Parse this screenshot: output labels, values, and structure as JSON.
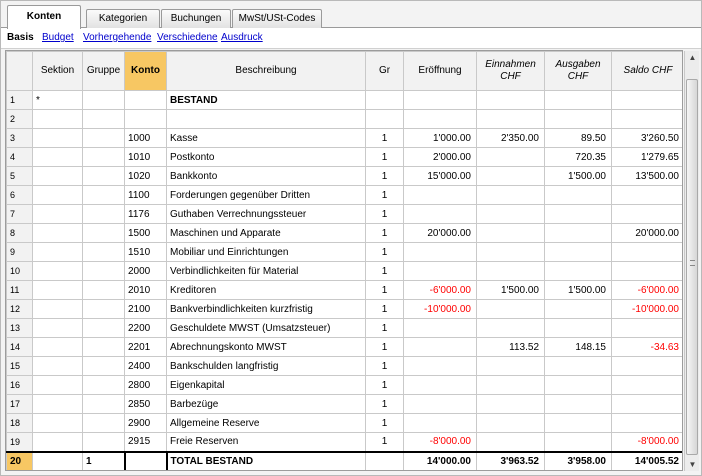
{
  "tabs": [
    {
      "label": "Konten",
      "active": true
    },
    {
      "label": "Kategorien",
      "active": false
    },
    {
      "label": "Buchungen",
      "active": false
    },
    {
      "label": "MwSt/USt-Codes",
      "active": false
    }
  ],
  "views": [
    {
      "label": "Basis",
      "current": true
    },
    {
      "label": "Budget",
      "current": false
    },
    {
      "label": "Vorhergehende",
      "current": false
    },
    {
      "label": "Verschiedene",
      "current": false
    },
    {
      "label": "Ausdruck",
      "current": false
    }
  ],
  "columns": {
    "rownum": "",
    "sektion": "Sektion",
    "gruppe": "Gruppe",
    "konto": "Konto",
    "beschreibung": "Beschreibung",
    "gr": "Gr",
    "eroeffnung": "Eröffnung",
    "einnahmen_1": "Einnahmen",
    "einnahmen_2": "CHF",
    "ausgaben_1": "Ausgaben",
    "ausgaben_2": "CHF",
    "saldo": "Saldo CHF"
  },
  "rows": [
    {
      "n": "1",
      "sektion": "*",
      "gruppe": "",
      "konto": "",
      "beschreibung": "BESTAND",
      "gr": "",
      "eroeffnung": "",
      "einnahmen": "",
      "ausgaben": "",
      "saldo": "",
      "bold": true
    },
    {
      "n": "2",
      "sektion": "",
      "gruppe": "",
      "konto": "",
      "beschreibung": "",
      "gr": "",
      "eroeffnung": "",
      "einnahmen": "",
      "ausgaben": "",
      "saldo": ""
    },
    {
      "n": "3",
      "sektion": "",
      "gruppe": "",
      "konto": "1000",
      "beschreibung": "Kasse",
      "gr": "1",
      "eroeffnung": "1'000.00",
      "einnahmen": "2'350.00",
      "ausgaben": "89.50",
      "saldo": "3'260.50"
    },
    {
      "n": "4",
      "sektion": "",
      "gruppe": "",
      "konto": "1010",
      "beschreibung": "Postkonto",
      "gr": "1",
      "eroeffnung": "2'000.00",
      "einnahmen": "",
      "ausgaben": "720.35",
      "saldo": "1'279.65"
    },
    {
      "n": "5",
      "sektion": "",
      "gruppe": "",
      "konto": "1020",
      "beschreibung": "Bankkonto",
      "gr": "1",
      "eroeffnung": "15'000.00",
      "einnahmen": "",
      "ausgaben": "1'500.00",
      "saldo": "13'500.00"
    },
    {
      "n": "6",
      "sektion": "",
      "gruppe": "",
      "konto": "1100",
      "beschreibung": "Forderungen gegenüber Dritten",
      "gr": "1",
      "eroeffnung": "",
      "einnahmen": "",
      "ausgaben": "",
      "saldo": ""
    },
    {
      "n": "7",
      "sektion": "",
      "gruppe": "",
      "konto": "1176",
      "beschreibung": "Guthaben Verrechnungssteuer",
      "gr": "1",
      "eroeffnung": "",
      "einnahmen": "",
      "ausgaben": "",
      "saldo": ""
    },
    {
      "n": "8",
      "sektion": "",
      "gruppe": "",
      "konto": "1500",
      "beschreibung": "Maschinen und Apparate",
      "gr": "1",
      "eroeffnung": "20'000.00",
      "einnahmen": "",
      "ausgaben": "",
      "saldo": "20'000.00"
    },
    {
      "n": "9",
      "sektion": "",
      "gruppe": "",
      "konto": "1510",
      "beschreibung": "Mobiliar und Einrichtungen",
      "gr": "1",
      "eroeffnung": "",
      "einnahmen": "",
      "ausgaben": "",
      "saldo": ""
    },
    {
      "n": "10",
      "sektion": "",
      "gruppe": "",
      "konto": "2000",
      "beschreibung": "Verbindlichkeiten für Material",
      "gr": "1",
      "eroeffnung": "",
      "einnahmen": "",
      "ausgaben": "",
      "saldo": ""
    },
    {
      "n": "11",
      "sektion": "",
      "gruppe": "",
      "konto": "2010",
      "beschreibung": "Kreditoren",
      "gr": "1",
      "eroeffnung": "-6'000.00",
      "einnahmen": "1'500.00",
      "ausgaben": "1'500.00",
      "saldo": "-6'000.00",
      "neg_eroeffnung": true,
      "neg_saldo": true
    },
    {
      "n": "12",
      "sektion": "",
      "gruppe": "",
      "konto": "2100",
      "beschreibung": "Bankverbindlichkeiten kurzfristig",
      "gr": "1",
      "eroeffnung": "-10'000.00",
      "einnahmen": "",
      "ausgaben": "",
      "saldo": "-10'000.00",
      "neg_eroeffnung": true,
      "neg_saldo": true
    },
    {
      "n": "13",
      "sektion": "",
      "gruppe": "",
      "konto": "2200",
      "beschreibung": "Geschuldete MWST (Umsatzsteuer)",
      "gr": "1",
      "eroeffnung": "",
      "einnahmen": "",
      "ausgaben": "",
      "saldo": ""
    },
    {
      "n": "14",
      "sektion": "",
      "gruppe": "",
      "konto": "2201",
      "beschreibung": "Abrechnungskonto MWST",
      "gr": "1",
      "eroeffnung": "",
      "einnahmen": "113.52",
      "ausgaben": "148.15",
      "saldo": "-34.63",
      "neg_saldo": true
    },
    {
      "n": "15",
      "sektion": "",
      "gruppe": "",
      "konto": "2400",
      "beschreibung": "Bankschulden langfristig",
      "gr": "1",
      "eroeffnung": "",
      "einnahmen": "",
      "ausgaben": "",
      "saldo": ""
    },
    {
      "n": "16",
      "sektion": "",
      "gruppe": "",
      "konto": "2800",
      "beschreibung": "Eigenkapital",
      "gr": "1",
      "eroeffnung": "",
      "einnahmen": "",
      "ausgaben": "",
      "saldo": ""
    },
    {
      "n": "17",
      "sektion": "",
      "gruppe": "",
      "konto": "2850",
      "beschreibung": "Barbezüge",
      "gr": "1",
      "eroeffnung": "",
      "einnahmen": "",
      "ausgaben": "",
      "saldo": ""
    },
    {
      "n": "18",
      "sektion": "",
      "gruppe": "",
      "konto": "2900",
      "beschreibung": "Allgemeine Reserve",
      "gr": "1",
      "eroeffnung": "",
      "einnahmen": "",
      "ausgaben": "",
      "saldo": ""
    },
    {
      "n": "19",
      "sektion": "",
      "gruppe": "",
      "konto": "2915",
      "beschreibung": "Freie Reserven",
      "gr": "1",
      "eroeffnung": "-8'000.00",
      "einnahmen": "",
      "ausgaben": "",
      "saldo": "-8'000.00",
      "neg_eroeffnung": true,
      "neg_saldo": true
    }
  ],
  "total": {
    "n": "20",
    "sektion": "",
    "gruppe": "1",
    "konto": "",
    "beschreibung": "TOTAL BESTAND",
    "gr": "",
    "eroeffnung": "14'000.00",
    "einnahmen": "3'963.52",
    "ausgaben": "3'958.00",
    "saldo": "14'005.52"
  },
  "colors": {
    "accent": "#f7c763",
    "negative": "#ff0000",
    "link": "#0000cc"
  },
  "icons": {
    "scroll_up": "scroll-up-arrow-icon",
    "scroll_down": "scroll-down-arrow-icon"
  }
}
